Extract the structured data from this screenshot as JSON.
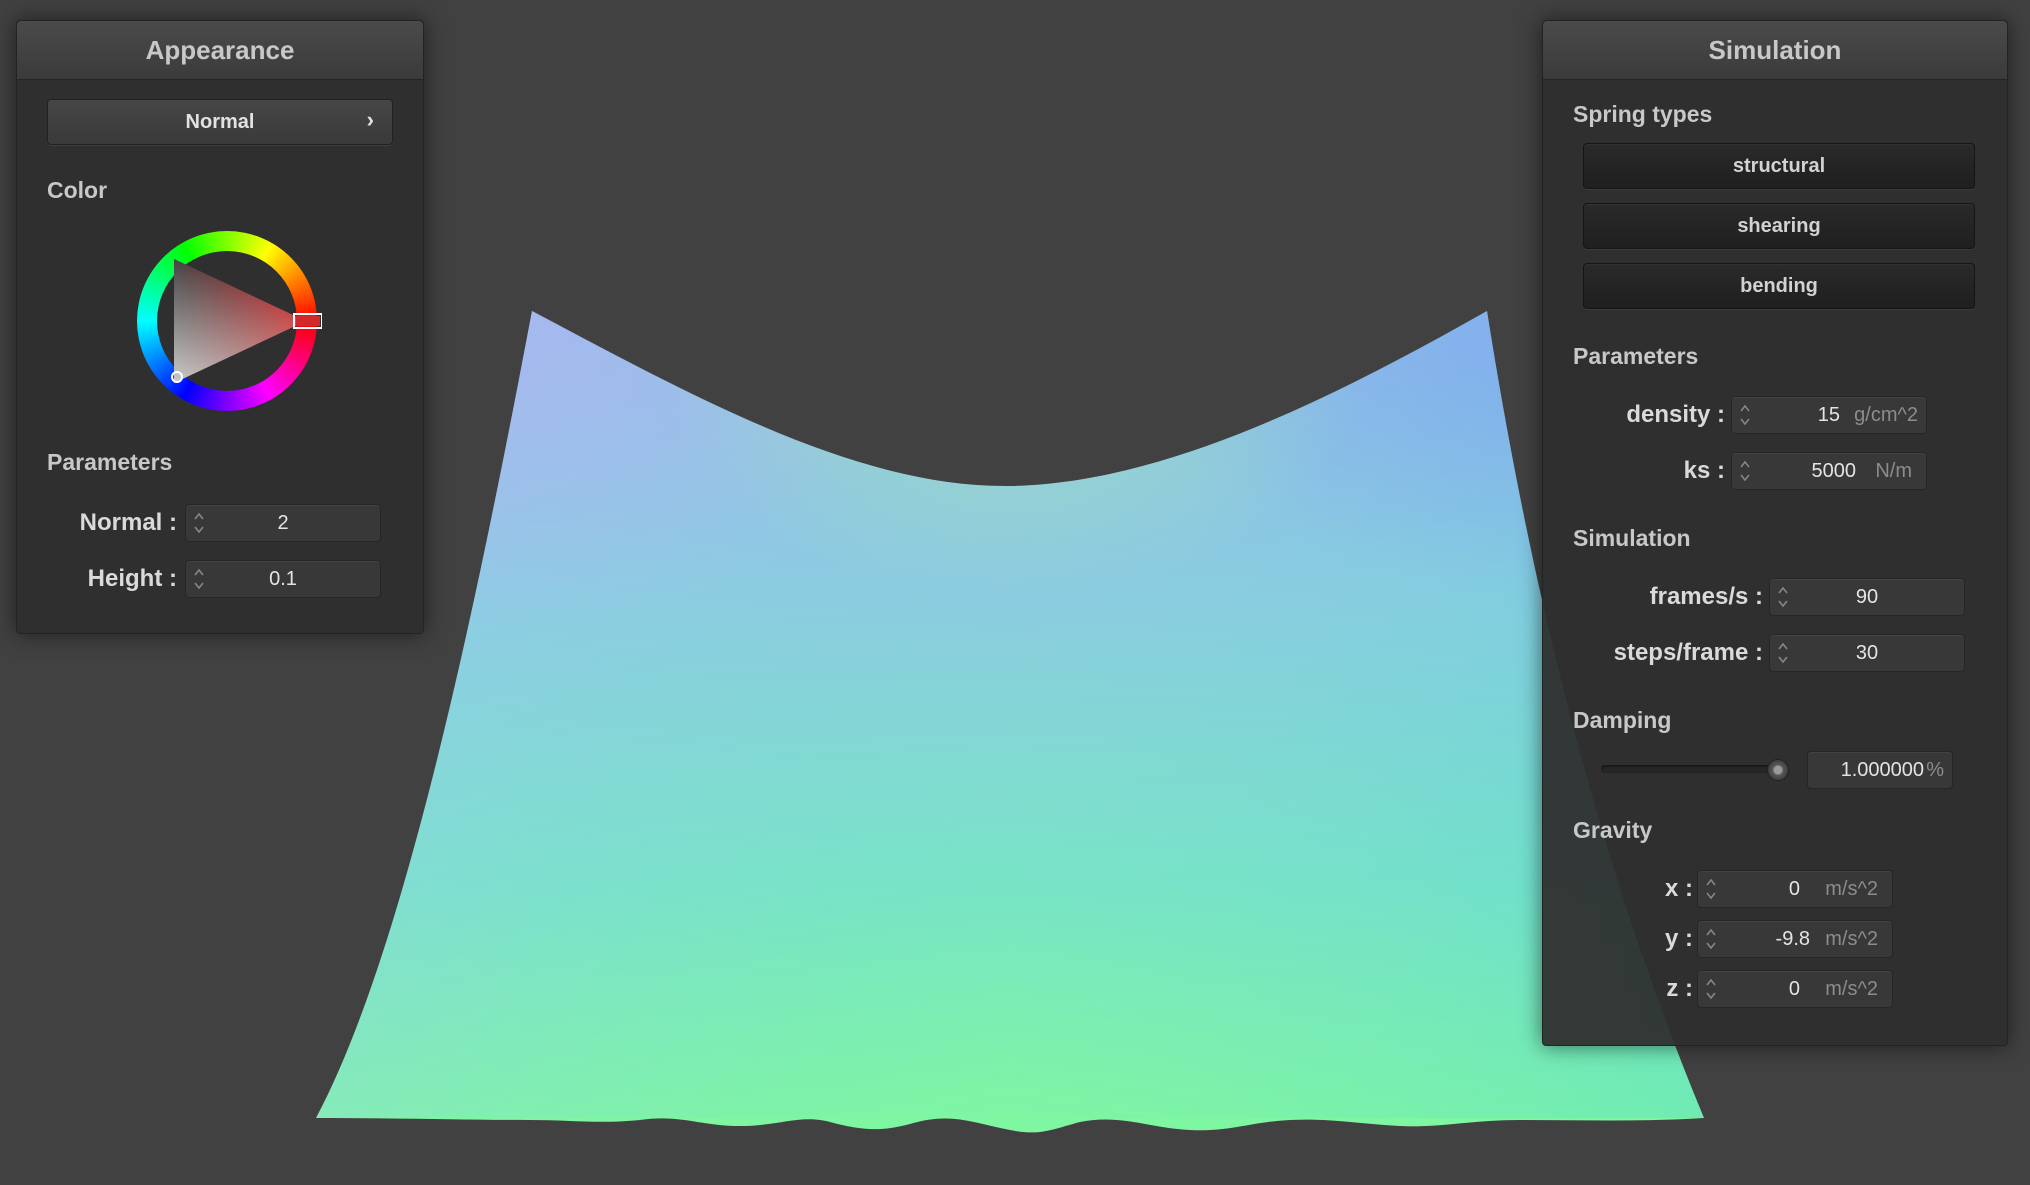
{
  "appearance": {
    "title": "Appearance",
    "mode_button": "Normal",
    "mode_chevron": "›",
    "color_label": "Color",
    "color_selected": "#d12a2a",
    "parameters_label": "Parameters",
    "normal_label": "Normal :",
    "normal_value": "2",
    "height_label": "Height :",
    "height_value": "0.1"
  },
  "simulation": {
    "title": "Simulation",
    "spring_types_label": "Spring types",
    "spring_buttons": [
      "structural",
      "shearing",
      "bending"
    ],
    "parameters_label": "Parameters",
    "density_label": "density :",
    "density_value": "15",
    "density_unit": "g/cm^2",
    "ks_label": "ks :",
    "ks_value": "5000",
    "ks_unit": "N/m",
    "simulation_label": "Simulation",
    "fps_label": "frames/s :",
    "fps_value": "90",
    "steps_label": "steps/frame :",
    "steps_value": "30",
    "damping_label": "Damping",
    "damping_slider_fraction": 1.0,
    "damping_value": "1.000000",
    "damping_unit": "%",
    "gravity_label": "Gravity",
    "gx_label": "x :",
    "gx_value": "0",
    "gy_label": "y :",
    "gy_value": "-9.8",
    "gz_label": "z :",
    "gz_value": "0",
    "gravity_unit": "m/s^2"
  },
  "colors": {
    "background": "#414141",
    "cloth_top": "#8ab8e6",
    "cloth_bottom": "#7cf5a6"
  }
}
